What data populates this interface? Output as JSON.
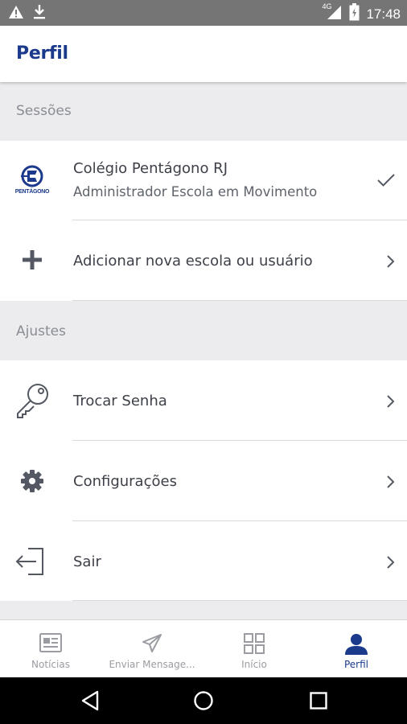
{
  "status_bar": {
    "time": "17:48",
    "network": "4G",
    "left_icons": [
      "warning-icon",
      "download-icon"
    ],
    "right_icons": [
      "signal-icon",
      "battery-icon"
    ]
  },
  "app_bar": {
    "title": "Perfil"
  },
  "sections": {
    "sessions": {
      "header": "Sessões",
      "items": [
        {
          "title": "Colégio Pentágono RJ",
          "subtitle": "Administrador Escola em Movimento",
          "logo_text": "PENTÁGONO",
          "trailing": "check-icon"
        },
        {
          "title": "Adicionar nova escola ou usuário",
          "icon": "plus-icon",
          "trailing": "chevron-right-icon"
        }
      ]
    },
    "settings": {
      "header": "Ajustes",
      "items": [
        {
          "title": "Trocar Senha",
          "icon": "key-icon",
          "trailing": "chevron-right-icon"
        },
        {
          "title": "Configurações",
          "icon": "gear-icon",
          "trailing": "chevron-right-icon"
        },
        {
          "title": "Sair",
          "icon": "logout-icon",
          "trailing": "chevron-right-icon"
        }
      ]
    }
  },
  "bottom_nav": {
    "active": "Perfil",
    "items": [
      {
        "label": "Notícias",
        "icon": "newspaper-icon"
      },
      {
        "label": "Enviar Mensage...",
        "icon": "paper-plane-icon"
      },
      {
        "label": "Início",
        "icon": "grid-icon"
      },
      {
        "label": "Perfil",
        "icon": "user-icon"
      }
    ]
  },
  "colors": {
    "accent": "#1b3a8c",
    "status_bar": "#757575",
    "section_bg": "#ececef",
    "text": "#3d4048",
    "muted": "#8a8d93"
  }
}
